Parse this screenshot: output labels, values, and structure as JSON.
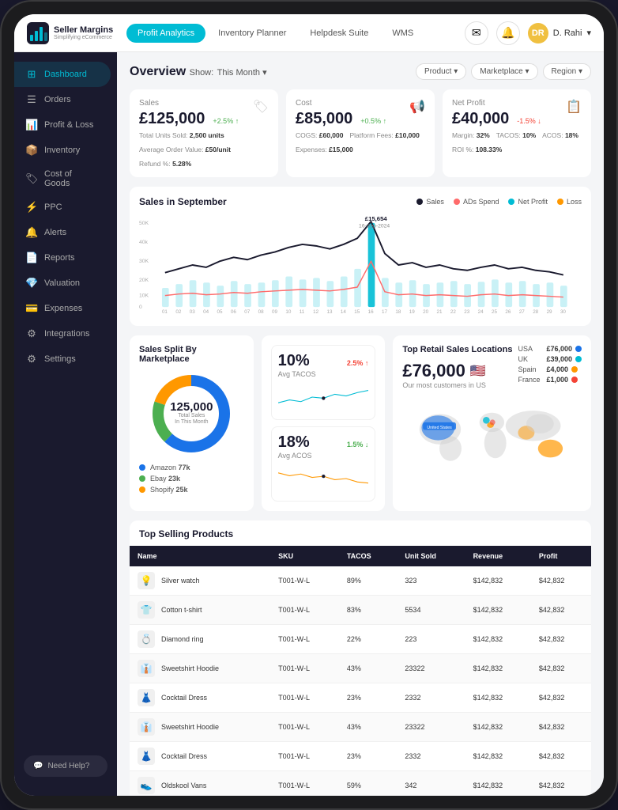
{
  "app": {
    "logo_main": "Seller Margins",
    "logo_sub": "Simplifying eCommerce"
  },
  "nav": {
    "tabs": [
      {
        "label": "Profit Analytics",
        "active": true
      },
      {
        "label": "Inventory Planner",
        "active": false
      },
      {
        "label": "Helpdesk Suite",
        "active": false
      },
      {
        "label": "WMS",
        "active": false
      }
    ],
    "user": "D. Rahi"
  },
  "sidebar": {
    "items": [
      {
        "label": "Dashboard",
        "icon": "⊞",
        "active": true
      },
      {
        "label": "Orders",
        "icon": "☰"
      },
      {
        "label": "Profit & Loss",
        "icon": "📊"
      },
      {
        "label": "Inventory",
        "icon": "📦"
      },
      {
        "label": "Cost of Goods",
        "icon": "🏷"
      },
      {
        "label": "PPC",
        "icon": "⚡"
      },
      {
        "label": "Alerts",
        "icon": "🔔"
      },
      {
        "label": "Reports",
        "icon": "📄"
      },
      {
        "label": "Valuation",
        "icon": "💎"
      },
      {
        "label": "Expenses",
        "icon": "💳"
      },
      {
        "label": "Integrations",
        "icon": "⚙"
      },
      {
        "label": "Settings",
        "icon": "⚙"
      }
    ],
    "help_label": "Need Help?"
  },
  "overview": {
    "title": "Overview",
    "show_label": "Show:",
    "period": "This Month",
    "filters": [
      "Product",
      "Marketplace",
      "Region"
    ]
  },
  "metrics": {
    "sales": {
      "label": "Sales",
      "value": "£125,000",
      "change": "+2.5% ↑",
      "change_type": "up",
      "stats": [
        {
          "label": "Total Units Sold:",
          "value": "2,500 units"
        },
        {
          "label": "Average Order Value:",
          "value": "£50/unit"
        },
        {
          "label": "Refund %:",
          "value": "5.28%"
        }
      ]
    },
    "cost": {
      "label": "Cost",
      "value": "£85,000",
      "change": "+0.5% ↑",
      "change_type": "up",
      "stats": [
        {
          "label": "COGS:",
          "value": "£60,000"
        },
        {
          "label": "Platform Fees:",
          "value": "£10,000"
        },
        {
          "label": "Expenses:",
          "value": "£15,000"
        }
      ]
    },
    "net_profit": {
      "label": "Net Profit",
      "value": "£40,000",
      "change": "-1.5% ↓",
      "change_type": "down",
      "stats": [
        {
          "label": "Margin:",
          "value": "32%"
        },
        {
          "label": "TACOS:",
          "value": "10%"
        },
        {
          "label": "ACOS:",
          "value": "18%"
        },
        {
          "label": "ROI %:",
          "value": "108.33%"
        }
      ]
    }
  },
  "chart": {
    "title": "Sales in September",
    "legend": [
      "Sales",
      "ADs Spend",
      "Net Profit",
      "Loss"
    ],
    "legend_colors": [
      "#1a1a2e",
      "#ff6b6b",
      "#00bcd4",
      "#ff9800"
    ],
    "peak_label": "£15,654",
    "peak_date": "16-Sep-2024",
    "x_labels": [
      "01",
      "02",
      "03",
      "04",
      "05",
      "06",
      "07",
      "08",
      "09",
      "10",
      "11",
      "12",
      "13",
      "14",
      "15",
      "16",
      "17",
      "18",
      "19",
      "20",
      "21",
      "22",
      "23",
      "24",
      "25",
      "26",
      "27",
      "28",
      "29",
      "30"
    ]
  },
  "marketplace_split": {
    "title": "Sales Split By Marketplace",
    "total_value": "125,000",
    "total_label": "Total Sales",
    "total_label2": "In This Month",
    "items": [
      {
        "label": "Amazon",
        "value": "77k",
        "color": "#1a73e8"
      },
      {
        "label": "Ebay",
        "value": "23k",
        "color": "#4caf50"
      },
      {
        "label": "Shopify",
        "value": "25k",
        "color": "#ff9800"
      }
    ],
    "donut_segments": [
      {
        "value": 62,
        "color": "#1a73e8"
      },
      {
        "value": 18,
        "color": "#4caf50"
      },
      {
        "value": 20,
        "color": "#ff9800"
      }
    ]
  },
  "kpi": {
    "tacos_value": "10%",
    "tacos_label": "Avg TACOS",
    "tacos_change": "2.5% ↑",
    "tacos_change_type": "up",
    "acos_value": "18%",
    "acos_label": "Avg ACOS",
    "acos_change": "1.5% ↓",
    "acos_change_type": "down"
  },
  "map_panel": {
    "title": "Top Retail Sales Locations",
    "value": "£76,000",
    "flag": "🇺🇸",
    "sub": "Our most customers in US",
    "locations": [
      {
        "label": "USA",
        "value": "£76,000",
        "color": "#1a73e8"
      },
      {
        "label": "UK",
        "value": "£39,000",
        "color": "#00bcd4"
      },
      {
        "label": "Spain",
        "value": "£4,000",
        "color": "#ff9800"
      },
      {
        "label": "France",
        "value": "£1,000",
        "color": "#f44336"
      }
    ]
  },
  "top_products": {
    "title": "Top Selling Products",
    "columns": [
      "Name",
      "SKU",
      "TACOS",
      "Unit Sold",
      "Revenue",
      "Profit"
    ],
    "rows": [
      {
        "icon": "💡",
        "name": "Silver watch",
        "sku": "T001-W-L",
        "tacos": "89%",
        "units": "323",
        "revenue": "$142,832",
        "profit": "$42,832"
      },
      {
        "icon": "👕",
        "name": "Cotton t-shirt",
        "sku": "T001-W-L",
        "tacos": "83%",
        "units": "5534",
        "revenue": "$142,832",
        "profit": "$42,832"
      },
      {
        "icon": "💍",
        "name": "Diamond ring",
        "sku": "T001-W-L",
        "tacos": "22%",
        "units": "223",
        "revenue": "$142,832",
        "profit": "$42,832"
      },
      {
        "icon": "👔",
        "name": "Sweetshirt Hoodie",
        "sku": "T001-W-L",
        "tacos": "43%",
        "units": "23322",
        "revenue": "$142,832",
        "profit": "$42,832"
      },
      {
        "icon": "👗",
        "name": "Cocktail Dress",
        "sku": "T001-W-L",
        "tacos": "23%",
        "units": "2332",
        "revenue": "$142,832",
        "profit": "$42,832"
      },
      {
        "icon": "👔",
        "name": "Sweetshirt Hoodie",
        "sku": "T001-W-L",
        "tacos": "43%",
        "units": "23322",
        "revenue": "$142,832",
        "profit": "$42,832"
      },
      {
        "icon": "👗",
        "name": "Cocktail Dress",
        "sku": "T001-W-L",
        "tacos": "23%",
        "units": "2332",
        "revenue": "$142,832",
        "profit": "$42,832"
      },
      {
        "icon": "👟",
        "name": "Oldskool Vans",
        "sku": "T001-W-L",
        "tacos": "59%",
        "units": "342",
        "revenue": "$142,832",
        "profit": "$42,832"
      }
    ]
  }
}
